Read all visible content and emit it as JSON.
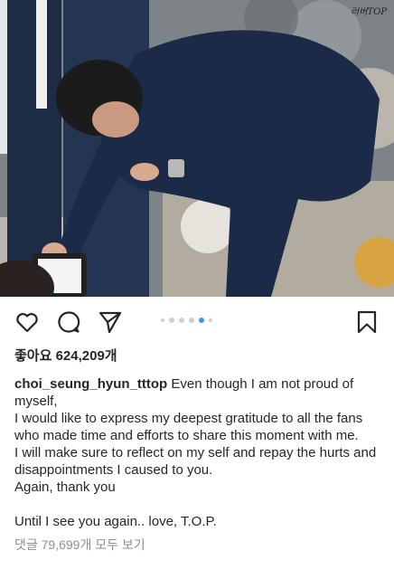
{
  "post": {
    "watermark": "러버TOP",
    "likes_text": "좋아요 624,209개",
    "username": "choi_seung_hyun_tttop",
    "caption_first": " Even though I am not proud of myself,",
    "caption_lines": [
      "I would like to express my deepest gratitude to all the fans who made time and efforts to share this moment with me.",
      "I will make sure to reflect on my self and repay the hurts and disappointments I caused to you.",
      "Again, thank you",
      "",
      "Until I see you again.. love, T.O.P."
    ],
    "comments_link": "댓글 79,699개 모두 보기"
  },
  "carousel": {
    "count": 6,
    "active_index": 3
  },
  "icons": {
    "like": "heart-icon",
    "comment": "comment-bubble-icon",
    "share": "paper-plane-icon",
    "save": "bookmark-icon"
  },
  "colors": {
    "text": "#262626",
    "muted": "#8e8e8e",
    "accent": "#3897f0"
  }
}
